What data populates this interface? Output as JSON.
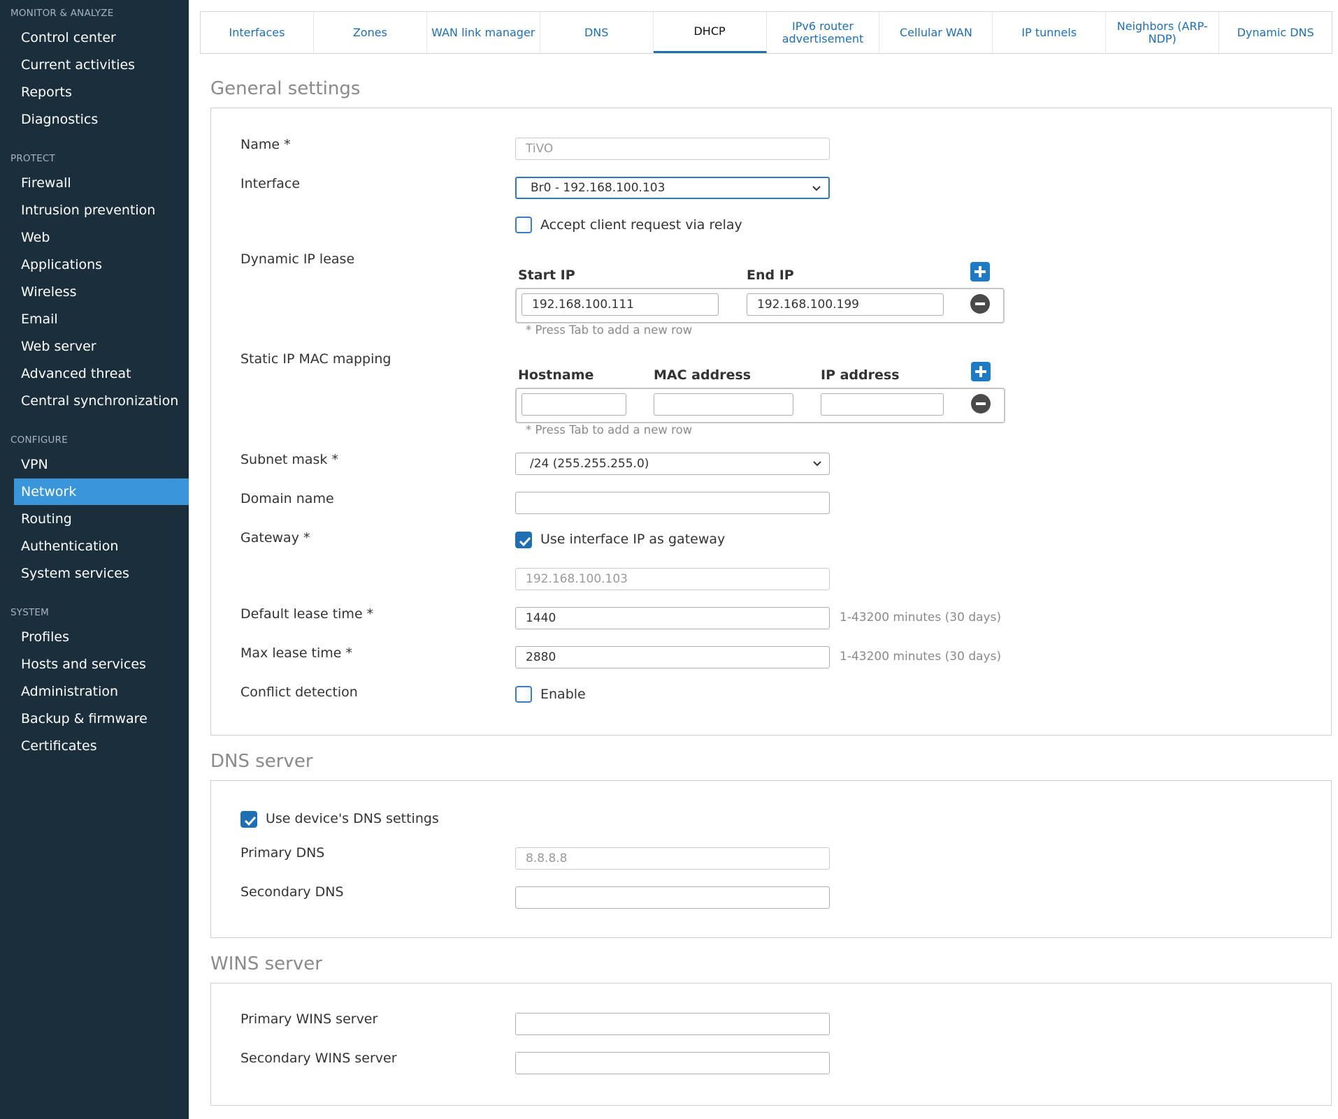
{
  "sidebar": {
    "sections": [
      {
        "title": "MONITOR & ANALYZE",
        "items": [
          "Control center",
          "Current activities",
          "Reports",
          "Diagnostics"
        ]
      },
      {
        "title": "PROTECT",
        "items": [
          "Firewall",
          "Intrusion prevention",
          "Web",
          "Applications",
          "Wireless",
          "Email",
          "Web server",
          "Advanced threat",
          "Central synchronization"
        ]
      },
      {
        "title": "CONFIGURE",
        "items": [
          "VPN",
          "Network",
          "Routing",
          "Authentication",
          "System services"
        ]
      },
      {
        "title": "SYSTEM",
        "items": [
          "Profiles",
          "Hosts and services",
          "Administration",
          "Backup & firmware",
          "Certificates"
        ]
      }
    ],
    "active_item": "Network"
  },
  "tabs": [
    "Interfaces",
    "Zones",
    "WAN link manager",
    "DNS",
    "DHCP",
    "IPv6 router advertisement",
    "Cellular WAN",
    "IP tunnels",
    "Neighbors (ARP-NDP)",
    "Dynamic DNS"
  ],
  "active_tab": "DHCP",
  "general": {
    "title": "General settings",
    "name_label": "Name *",
    "name_value": "TiVO",
    "interface_label": "Interface",
    "interface_value": "Br0 - 192.168.100.103",
    "relay_label": "Accept client request via relay",
    "relay_checked": false,
    "dynamic_label": "Dynamic IP lease",
    "start_ip_header": "Start IP",
    "end_ip_header": "End IP",
    "start_ip": "192.168.100.111",
    "end_ip": "192.168.100.199",
    "dynamic_hint": "* Press Tab to add a new row",
    "static_label": "Static IP MAC mapping",
    "hostname_header": "Hostname",
    "mac_header": "MAC address",
    "ip_header": "IP address",
    "hostname_value": "",
    "mac_value": "",
    "ip_value": "",
    "static_hint": "* Press Tab to add a new row",
    "subnet_label": "Subnet mask *",
    "subnet_value": "/24 (255.255.255.0)",
    "domain_label": "Domain name",
    "domain_value": "",
    "gateway_label": "Gateway *",
    "gateway_cb_label": "Use interface IP as gateway",
    "gateway_checked": true,
    "gateway_value": "192.168.100.103",
    "default_lease_label": "Default lease time *",
    "default_lease_value": "1440",
    "default_lease_help": "1-43200 minutes (30 days)",
    "max_lease_label": "Max lease time *",
    "max_lease_value": "2880",
    "max_lease_help": "1-43200 minutes (30 days)",
    "conflict_label": "Conflict detection",
    "conflict_cb_label": "Enable",
    "conflict_checked": false
  },
  "dns": {
    "title": "DNS server",
    "use_device_label": "Use device's DNS settings",
    "use_device_checked": true,
    "primary_label": "Primary DNS",
    "primary_value": "8.8.8.8",
    "secondary_label": "Secondary DNS",
    "secondary_value": ""
  },
  "wins": {
    "title": "WINS server",
    "primary_label": "Primary WINS server",
    "primary_value": "",
    "secondary_label": "Secondary WINS server",
    "secondary_value": ""
  },
  "colors": {
    "sidebar_bg": "#1b2e3c",
    "active_blue": "#3a96d8",
    "link_blue": "#1f6fb5"
  }
}
